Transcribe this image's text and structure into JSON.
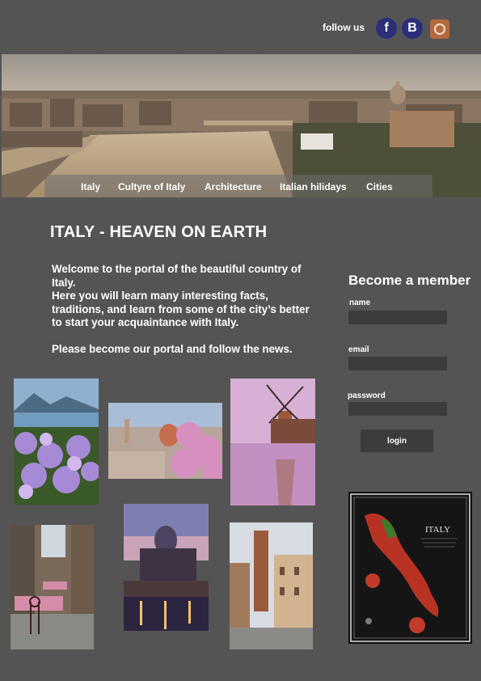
{
  "header": {
    "follow_label": "follow us",
    "social": [
      {
        "name": "facebook-icon",
        "glyph": "f"
      },
      {
        "name": "b-social-icon",
        "glyph": "B"
      },
      {
        "name": "instagram-icon",
        "glyph": ""
      }
    ]
  },
  "nav": {
    "items": [
      "Italy",
      "Cultyre of Italy",
      "Architecture",
      "Italian hilidays",
      "Cities"
    ]
  },
  "main": {
    "title": "ITALY - HEAVEN ON EARTH",
    "intro": [
      "Welcome to the portal of the beautiful country of Italy.",
      "Here you will learn many interesting facts, traditions, and learn from some of the city’s better to start your acquaintance with Italy."
    ],
    "cta": "Please become our portal and follow the news."
  },
  "form": {
    "heading": "Become a member",
    "name_label": "name",
    "email_label": "email",
    "password_label": "password",
    "login_label": "login"
  },
  "poster": {
    "text": "ITALY"
  },
  "colors": {
    "background": "#555454",
    "input_bg": "#3c3c3c",
    "social_bg": "#2b2f7a",
    "instagram_bg": "#b46a3c"
  }
}
